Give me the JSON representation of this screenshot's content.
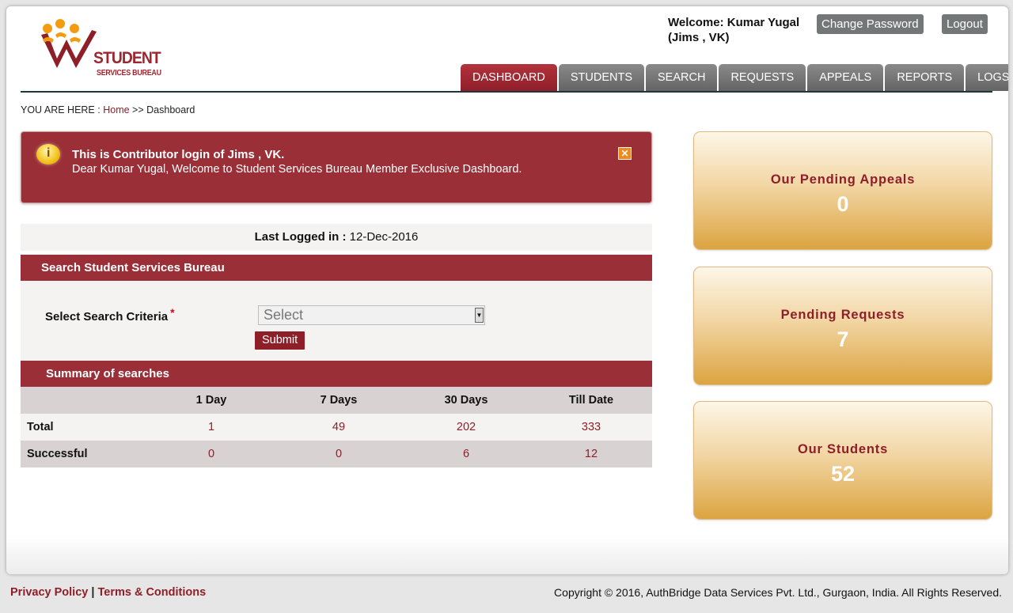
{
  "logo": {
    "line1": "STUDENT",
    "line2": "SERVICES BUREAU"
  },
  "header": {
    "welcome_line1": "Welcome: Kumar Yugal",
    "welcome_line2": "(Jims , VK)",
    "change_password": "Change Password",
    "logout": "Logout"
  },
  "nav": {
    "tabs": [
      {
        "label": "DASHBOARD",
        "active": true
      },
      {
        "label": "STUDENTS"
      },
      {
        "label": "SEARCH"
      },
      {
        "label": "REQUESTS"
      },
      {
        "label": "APPEALS"
      },
      {
        "label": "REPORTS"
      },
      {
        "label": "LOGS"
      }
    ]
  },
  "breadcrumb": {
    "prefix": "YOU ARE HERE :",
    "home": "Home",
    "sep": ">>",
    "current": "Dashboard"
  },
  "alert": {
    "title": "This is Contributor login of Jims , VK.",
    "message": "Dear Kumar Yugal, Welcome to Student Services Bureau Member Exclusive Dashboard.",
    "close": "✕",
    "icon": "info-icon"
  },
  "last_logged": {
    "label": "Last Logged in :",
    "value": "12-Dec-2016"
  },
  "search": {
    "title": "Search Student Services Bureau",
    "criteria_label": "Select Search Criteria",
    "required_mark": "*",
    "select_value": "Select",
    "submit": "Submit"
  },
  "summary": {
    "title": "Summary of searches",
    "columns": [
      "",
      "1 Day",
      "7 Days",
      "30 Days",
      "Till Date"
    ],
    "rows": [
      {
        "label": "Total",
        "values": [
          "1",
          "49",
          "202",
          "333"
        ]
      },
      {
        "label": "Successful",
        "values": [
          "0",
          "0",
          "6",
          "12"
        ]
      }
    ]
  },
  "cards": [
    {
      "label": "Our Pending Appeals",
      "value": "0"
    },
    {
      "label": "Pending Requests",
      "value": "7"
    },
    {
      "label": "Our Students",
      "value": "52"
    }
  ],
  "footer": {
    "privacy": "Privacy Policy",
    "separator": "|",
    "terms": "Terms & Conditions",
    "copyright": "Copyright © 2016, AuthBridge Data Services Pvt. Ltd., Gurgaon, India. All Rights Reserved."
  },
  "colors": {
    "brand": "#9a2f37",
    "nav": "#747778",
    "card_gold": "#dca441"
  }
}
